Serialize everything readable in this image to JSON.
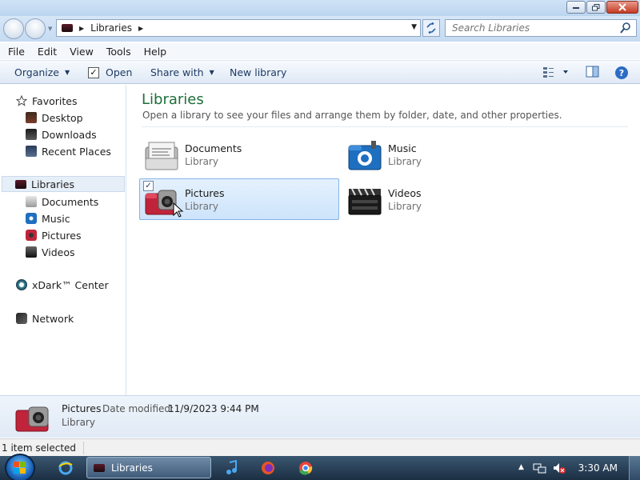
{
  "window": {
    "controls": [
      "minimize",
      "maximize",
      "close"
    ]
  },
  "address": {
    "crumb": "Libraries",
    "search_placeholder": "Search Libraries"
  },
  "menu": {
    "items": [
      "File",
      "Edit",
      "View",
      "Tools",
      "Help"
    ]
  },
  "toolbar": {
    "organize": "Organize",
    "open": "Open",
    "share_with": "Share with",
    "new_library": "New library"
  },
  "nav": {
    "favorites": "Favorites",
    "desktop": "Desktop",
    "downloads": "Downloads",
    "recent_places": "Recent Places",
    "libraries": "Libraries",
    "documents": "Documents",
    "music": "Music",
    "pictures": "Pictures",
    "videos": "Videos",
    "xdark_center": "xDark™ Center",
    "network": "Network"
  },
  "content": {
    "title": "Libraries",
    "subtitle": "Open a library to see your files and arrange them by folder, date, and other properties.",
    "libraries": [
      {
        "name": "Documents",
        "type": "Library"
      },
      {
        "name": "Music",
        "type": "Library"
      },
      {
        "name": "Pictures",
        "type": "Library",
        "selected": true
      },
      {
        "name": "Videos",
        "type": "Library"
      }
    ]
  },
  "details": {
    "name": "Pictures",
    "date_label": "Date modified:",
    "date_value": "11/9/2023 9:44 PM",
    "type": "Library"
  },
  "status": {
    "text": "1 item selected"
  },
  "taskbar": {
    "active_task": "Libraries",
    "clock": "3:30 AM"
  },
  "colors": {
    "title_green": "#1e6f3a",
    "selection_bg": "#cde4fb",
    "selection_border": "#84b4e6",
    "taskbar": "#1c2f43"
  }
}
